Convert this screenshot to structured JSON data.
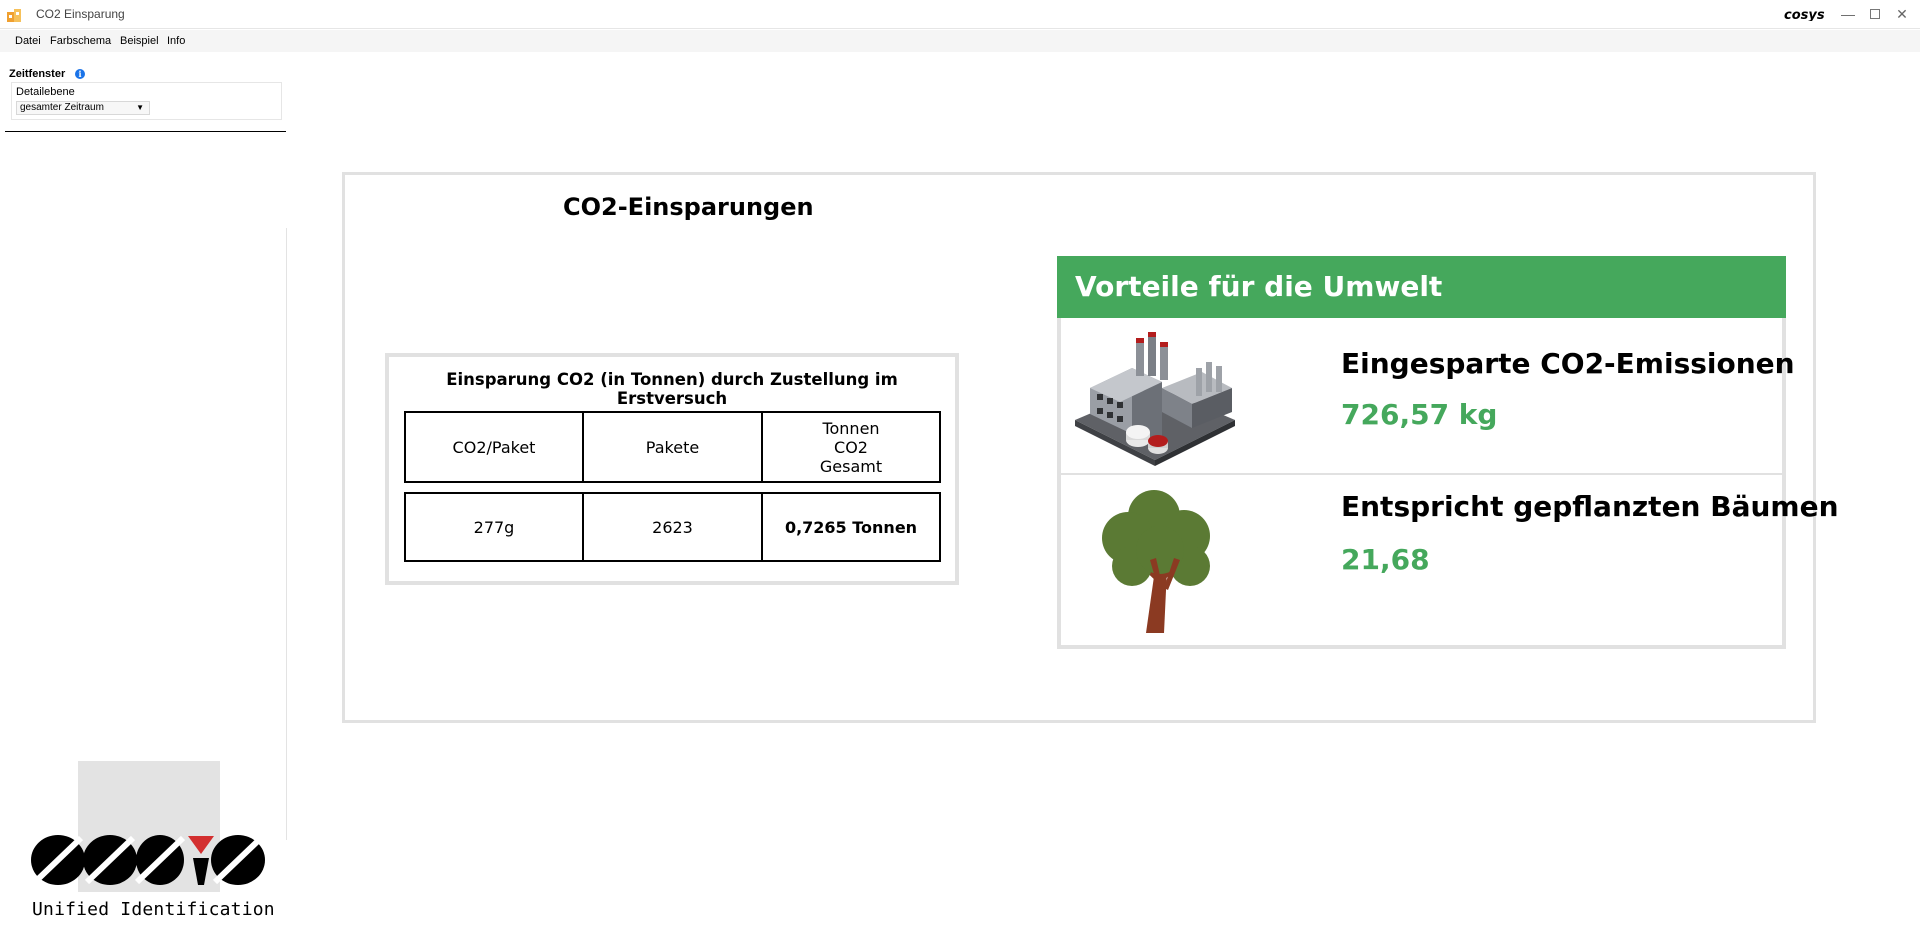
{
  "window": {
    "title": "CO2 Einsparung"
  },
  "menu": {
    "items": [
      "Datei",
      "Farbschema",
      "Beispiel",
      "Info"
    ]
  },
  "sidebar": {
    "section_title": "Zeitfenster",
    "detail_label": "Detailebene",
    "detail_value": "gesamter Zeitraum"
  },
  "logo": {
    "tagline": "Unified Identification"
  },
  "main": {
    "title": "CO2-Einsparungen",
    "table": {
      "caption": "Einsparung CO2 (in Tonnen) durch Zustellung im Erstversuch",
      "headers": [
        "CO2/Paket",
        "Pakete",
        "Tonnen CO2 Gesamt"
      ],
      "values": [
        "277g",
        "2623",
        "0,7265 Tonnen"
      ]
    },
    "benefits": {
      "title": "Vorteile für die Umwelt",
      "items": [
        {
          "label": "Eingesparte CO2-Emissionen",
          "value": "726,57 kg",
          "icon": "factory-icon"
        },
        {
          "label": "Entspricht gepflanzten Bäumen",
          "value": "21,68",
          "icon": "tree-icon"
        }
      ]
    }
  },
  "colors": {
    "accent_green": "#45a85c",
    "panel_border": "#e1e1e1"
  }
}
